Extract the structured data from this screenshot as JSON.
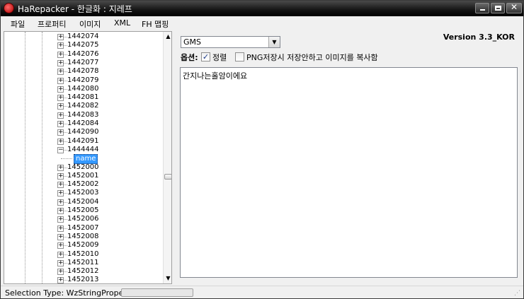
{
  "window": {
    "title": "HaRepacker - 한글화 : 지레프",
    "buttons": {
      "minimize": "minimize",
      "maximize": "maximize",
      "close": "✕"
    }
  },
  "menu": [
    "파일",
    "프로퍼티",
    "이미지",
    "XML",
    "FH 맵핑"
  ],
  "tree": {
    "nodes": [
      {
        "label": "1442074",
        "expanded": false
      },
      {
        "label": "1442075",
        "expanded": false
      },
      {
        "label": "1442076",
        "expanded": false
      },
      {
        "label": "1442077",
        "expanded": false
      },
      {
        "label": "1442078",
        "expanded": false
      },
      {
        "label": "1442079",
        "expanded": false
      },
      {
        "label": "1442080",
        "expanded": false
      },
      {
        "label": "1442081",
        "expanded": false
      },
      {
        "label": "1442082",
        "expanded": false
      },
      {
        "label": "1442083",
        "expanded": false
      },
      {
        "label": "1442084",
        "expanded": false
      },
      {
        "label": "1442090",
        "expanded": false
      },
      {
        "label": "1442091",
        "expanded": false
      },
      {
        "label": "1444444",
        "expanded": true
      },
      {
        "label": "name",
        "child": true,
        "selected": true
      },
      {
        "label": "1452000",
        "expanded": false
      },
      {
        "label": "1452001",
        "expanded": false
      },
      {
        "label": "1452002",
        "expanded": false
      },
      {
        "label": "1452003",
        "expanded": false
      },
      {
        "label": "1452004",
        "expanded": false
      },
      {
        "label": "1452005",
        "expanded": false
      },
      {
        "label": "1452006",
        "expanded": false
      },
      {
        "label": "1452007",
        "expanded": false
      },
      {
        "label": "1452008",
        "expanded": false
      },
      {
        "label": "1452009",
        "expanded": false
      },
      {
        "label": "1452010",
        "expanded": false
      },
      {
        "label": "1452011",
        "expanded": false
      },
      {
        "label": "1452012",
        "expanded": false
      },
      {
        "label": "1452013",
        "expanded": false
      }
    ]
  },
  "editor": {
    "version_dropdown": "GMS",
    "version_text": "Version 3.3_KOR",
    "options_label": "옵션:",
    "sort_checkbox": {
      "label": "정렬",
      "checked": true
    },
    "png_checkbox": {
      "label": "PNG저장시 저장안하고 이미지를 복사함",
      "checked": false
    },
    "text_value": "간지나는홀암이에요"
  },
  "status": {
    "text": "Selection Type: WzStringProperty",
    "progress": 0
  },
  "colors": {
    "selection": "#3399ff",
    "titlebar": "#141414"
  }
}
